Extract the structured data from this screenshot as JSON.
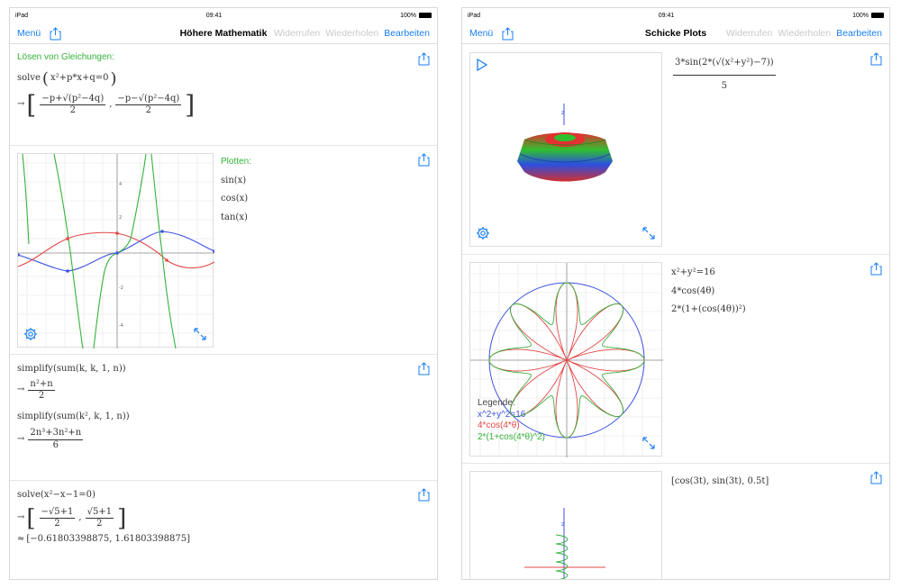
{
  "left": {
    "status": {
      "device": "iPad",
      "time": "09:41",
      "battery": "100%"
    },
    "nav": {
      "menu": "Menü",
      "title": "Höhere Mathematik",
      "undo": "Widerrufen",
      "redo": "Wiederholen",
      "edit": "Bearbeiten"
    },
    "cell1": {
      "heading": "Lösen von Gleichungen:",
      "cmd": "solve",
      "eq": "x²+p*x+q=0",
      "arrow": "→",
      "frac1_num": "−p+√(p²−4q)",
      "frac1_den": "2",
      "frac2_num": "−p−√(p²−4q)",
      "frac2_den": "2"
    },
    "cell2": {
      "heading": "Plotten:",
      "items": [
        "sin(x)",
        "cos(x)",
        "tan(x)"
      ]
    },
    "cell3": {
      "cmd1": "simplify(sum(k, k, 1, n))",
      "arrow": "→",
      "r1_num": "n²+n",
      "r1_den": "2",
      "cmd2": "simplify(sum(k², k, 1, n))",
      "r2_num": "2n³+3n²+n",
      "r2_den": "6"
    },
    "cell4": {
      "cmd": "solve(x²−x−1=0)",
      "arrow": "→",
      "f1_num": "−√5+1",
      "f1_den": "2",
      "f2_num": "√5+1",
      "f2_den": "2",
      "approx": "≈",
      "approx_val": "[−0.61803398875, 1.61803398875]"
    }
  },
  "right": {
    "status": {
      "device": "iPad",
      "time": "09:41",
      "battery": "100%"
    },
    "nav": {
      "menu": "Menü",
      "title": "Schicke Plots",
      "undo": "Widerrufen",
      "redo": "Wiederholen",
      "edit": "Bearbeiten"
    },
    "cell1": {
      "num": "3*sin(2*(√(x²+y²)−7))",
      "den": "5"
    },
    "cell2": {
      "items": [
        "x²+y²=16",
        "4*cos(4θ)",
        "2*(1+(cos(4θ))²)"
      ],
      "legend_title": "Legende:",
      "legend": [
        "x^2+y^2=16",
        "4*cos(4*θ)",
        "2*(1+cos(4*θ)^2)"
      ]
    },
    "cell3": {
      "expr": "[cos(3t), sin(3t), 0.5t]"
    }
  },
  "colors": {
    "accent": "#1a7ff2",
    "green": "#35b23a",
    "red": "#e34848",
    "blue": "#3d52e0"
  }
}
